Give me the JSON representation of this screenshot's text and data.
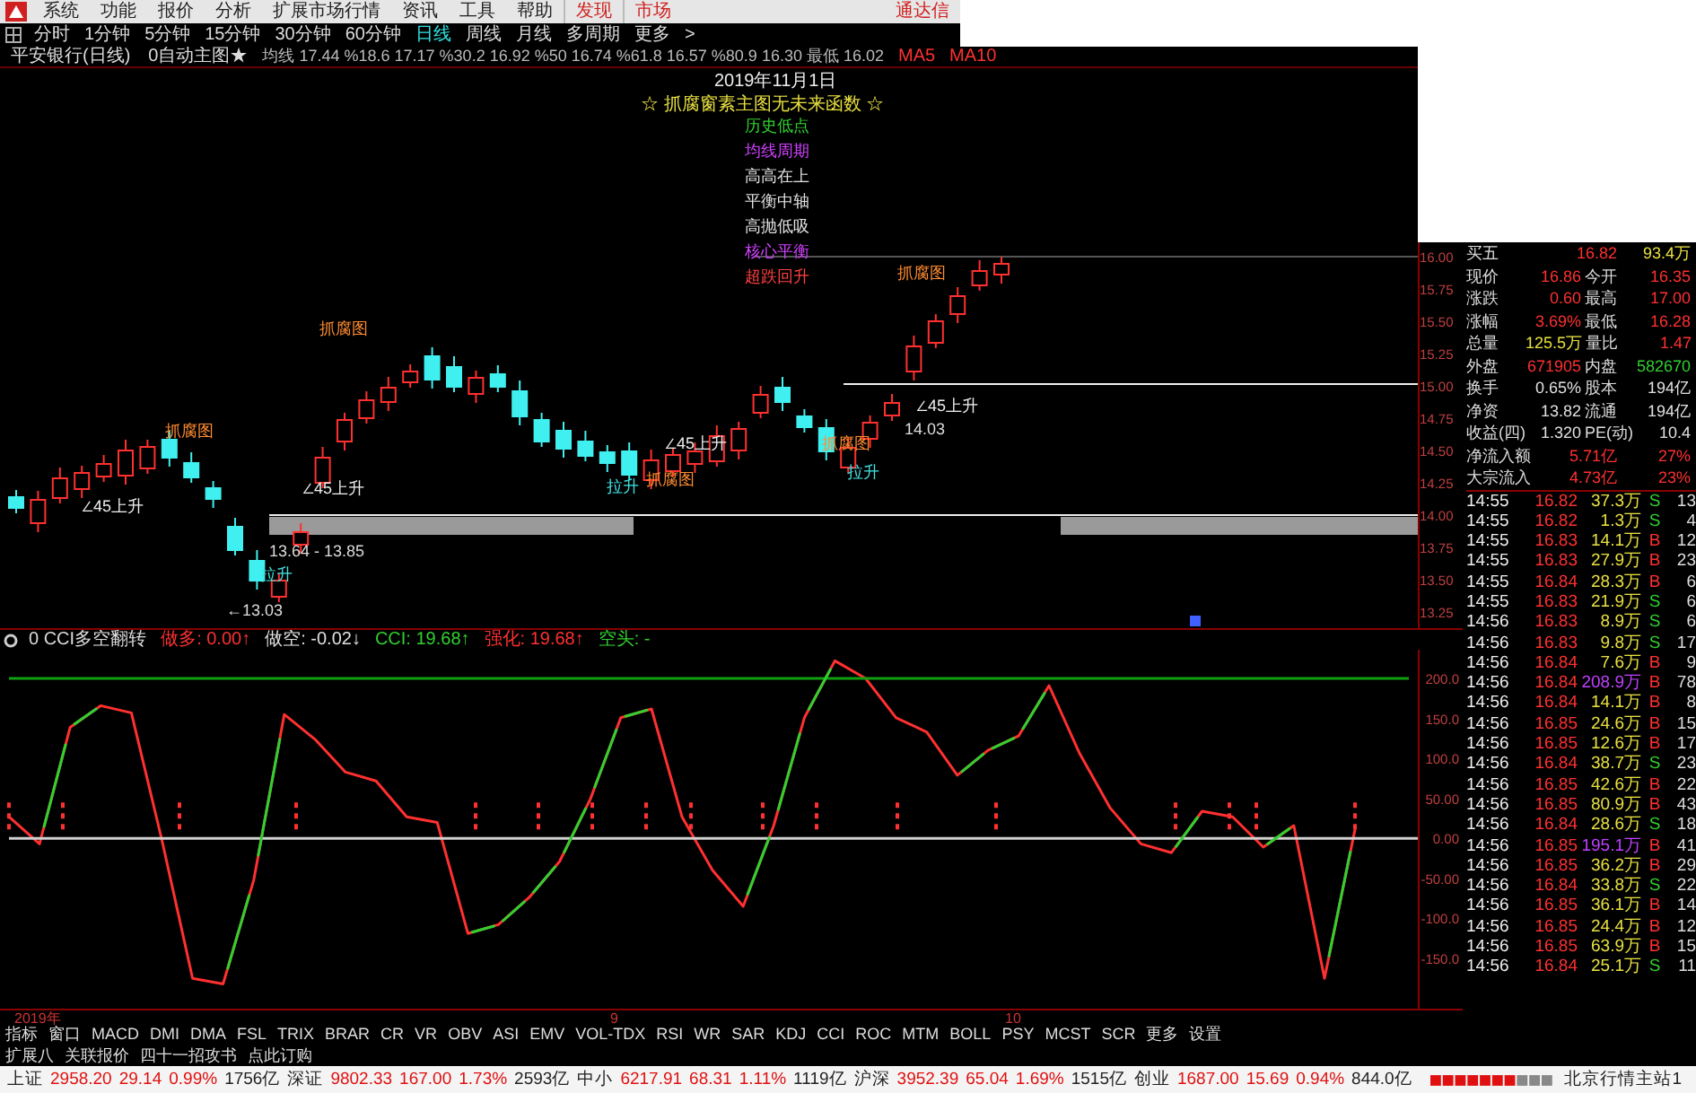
{
  "menu_bar": {
    "items": [
      {
        "label": "系统",
        "kind": "menu"
      },
      {
        "label": "功能",
        "kind": "menu"
      },
      {
        "label": "报价",
        "kind": "menu"
      },
      {
        "label": "分析",
        "kind": "menu"
      },
      {
        "label": "扩展市场行情",
        "kind": "menu"
      },
      {
        "label": "资讯",
        "kind": "menu"
      },
      {
        "label": "工具",
        "kind": "menu"
      },
      {
        "label": "帮助",
        "kind": "menu"
      },
      {
        "label": "发现",
        "kind": "feature"
      },
      {
        "label": "市场",
        "kind": "feature"
      }
    ],
    "brand": "通达信"
  },
  "period_bar": {
    "items": [
      {
        "label": "分时",
        "selected": false
      },
      {
        "label": "1分钟",
        "selected": false
      },
      {
        "label": "5分钟",
        "selected": false
      },
      {
        "label": "15分钟",
        "selected": false
      },
      {
        "label": "30分钟",
        "selected": false
      },
      {
        "label": "60分钟",
        "selected": false
      },
      {
        "label": "日线",
        "selected": true
      },
      {
        "label": "周线",
        "selected": false
      },
      {
        "label": "月线",
        "selected": false
      },
      {
        "label": "多周期",
        "selected": false
      },
      {
        "label": "更多",
        "selected": false
      }
    ],
    "arrow": ">"
  },
  "chart_header": {
    "title": "平安银行(日线)",
    "indicator": "0自动主图★",
    "values": "均线 17.44 %18.6 17.17 %30.2 16.92 %50 16.74 %61.8 16.57 %80.9 16.30 最低 16.02",
    "legend": [
      "MA5",
      "MA10"
    ]
  },
  "main_chart": {
    "date": "2019年11月1日",
    "caption": "☆ 抓腐窗素主图无未来函数 ☆",
    "levels": [
      {
        "label": "历史低点",
        "color": "#30d030"
      },
      {
        "label": "均线周期",
        "color": "#d040ff"
      },
      {
        "label": "高高在上",
        "color": "#e0e0e0"
      },
      {
        "label": "平衡中轴",
        "color": "#e0e0e0"
      },
      {
        "label": "高抛低吸",
        "color": "#e0e0e0"
      },
      {
        "label": "核心平衡",
        "color": "#d040ff"
      },
      {
        "label": "超跌回升",
        "color": "#ff4040"
      }
    ],
    "signals": [
      {
        "text": "抓腐图",
        "kind": "top"
      },
      {
        "text": "抓腐图",
        "kind": "top"
      },
      {
        "text": "抓腐图",
        "kind": "top"
      },
      {
        "text": "抓腐图",
        "kind": "top"
      },
      {
        "text": "抓腐图",
        "kind": "top"
      },
      {
        "text": "拉升",
        "kind": "rise"
      },
      {
        "text": "拉升",
        "kind": "rise"
      },
      {
        "text": "拉升",
        "kind": "rise"
      },
      {
        "text": "∠45上升",
        "kind": "trend"
      },
      {
        "text": "∠45上升",
        "kind": "trend"
      },
      {
        "text": "∠45上升",
        "kind": "trend"
      },
      {
        "text": "∠45上升",
        "kind": "trend"
      },
      {
        "text": "13.64 - 13.85",
        "kind": "note"
      },
      {
        "text": "←13.03",
        "kind": "note"
      },
      {
        "text": "14.03",
        "kind": "note"
      }
    ],
    "price_axis": [
      "16.00",
      "15.75",
      "15.50",
      "15.25",
      "15.00",
      "14.75",
      "14.50",
      "14.25",
      "14.00",
      "13.75",
      "13.50",
      "13.25"
    ]
  },
  "indicator_header": {
    "name": "0 CCI多空翻转",
    "items": [
      {
        "text": "做多: 0.00↑",
        "color": "#ff3030"
      },
      {
        "text": "做空: -0.02↓",
        "color": "#e0e0e0"
      },
      {
        "text": "CCI: 19.68↑",
        "color": "#30d030"
      },
      {
        "text": "强化: 19.68↑",
        "color": "#ff3030"
      },
      {
        "text": "空头: -",
        "color": "#30d030"
      }
    ]
  },
  "indicator_chart": {
    "chart_data": {
      "type": "line",
      "ylim": [
        -213,
        236
      ],
      "yticks": [
        {
          "value": 200,
          "label": "200.0"
        },
        {
          "value": 150,
          "label": "150.0"
        },
        {
          "value": 100,
          "label": "100.0"
        },
        {
          "value": 50,
          "label": "50.00"
        },
        {
          "value": 0,
          "label": "0.00"
        },
        {
          "value": -50,
          "label": "-50.00"
        },
        {
          "value": -100,
          "label": "-100.0"
        },
        {
          "value": -150,
          "label": "-150.0"
        }
      ],
      "categories": [
        null,
        null,
        null,
        null,
        null,
        null,
        null,
        null,
        null,
        null,
        null,
        null,
        null,
        null,
        null,
        null,
        null,
        null,
        null,
        null,
        null,
        null,
        null,
        null,
        null,
        null,
        null,
        null,
        null,
        null,
        null,
        null,
        null,
        null,
        null,
        null,
        null,
        null,
        null,
        null,
        null,
        null,
        null,
        null,
        null
      ],
      "series": [
        {
          "color": "#ff3030",
          "values": [
            27,
            -7,
            139,
            166,
            157,
            -2,
            -175,
            -182,
            -52,
            155,
            124,
            83,
            72,
            27,
            20,
            -119,
            -108,
            -74,
            -29,
            49,
            151,
            162,
            27,
            -40,
            -85,
            16,
            151,
            222,
            200,
            151,
            133,
            79,
            110,
            128,
            191,
            106,
            38,
            -7,
            -18,
            34,
            27,
            -11,
            16,
            -175,
            11
          ]
        }
      ]
    }
  },
  "date_axis": [
    "2019年",
    "9",
    "10"
  ],
  "indicator_tabs": [
    "指标",
    "窗口",
    "MACD",
    "DMI",
    "DMA",
    "FSL",
    "TRIX",
    "BRAR",
    "CR",
    "VR",
    "OBV",
    "ASI",
    "EMV",
    "VOL-TDX",
    "RSI",
    "WR",
    "SAR",
    "KDJ",
    "CCI",
    "ROC",
    "MTM",
    "BOLL",
    "PSY",
    "MCST",
    "SCR",
    "更多",
    "设置"
  ],
  "extra_links": [
    "扩展八",
    "关联报价",
    "四十一招攻书",
    "点此订购"
  ],
  "quote_panel": {
    "rows": [
      {
        "kind": "pair",
        "cells": [
          {
            "text": "买五"
          },
          {
            "text": "16.82",
            "color": "#ff3030"
          },
          {
            "text": "93.4万",
            "color": "#e8e040"
          }
        ]
      },
      {
        "kind": "quad",
        "cells": [
          {
            "text": "现价"
          },
          {
            "text": "16.86",
            "color": "#ff3030"
          },
          {
            "text": "今开"
          },
          {
            "text": "16.35",
            "color": "#ff3030"
          }
        ]
      },
      {
        "kind": "quad",
        "cells": [
          {
            "text": "涨跌"
          },
          {
            "text": "0.60",
            "color": "#ff3030"
          },
          {
            "text": "最高"
          },
          {
            "text": "17.00",
            "color": "#ff3030"
          }
        ]
      },
      {
        "kind": "quad",
        "cells": [
          {
            "text": "涨幅"
          },
          {
            "text": "3.69%",
            "color": "#ff3030"
          },
          {
            "text": "最低"
          },
          {
            "text": "16.28",
            "color": "#ff3030"
          }
        ]
      },
      {
        "kind": "quad",
        "cells": [
          {
            "text": "总量"
          },
          {
            "text": "125.5万",
            "color": "#e8e040"
          },
          {
            "text": "量比"
          },
          {
            "text": "1.47",
            "color": "#ff3030"
          }
        ]
      },
      {
        "kind": "quad",
        "cells": [
          {
            "text": "外盘"
          },
          {
            "text": "671905",
            "color": "#ff3030"
          },
          {
            "text": "内盘"
          },
          {
            "text": "582670",
            "color": "#30d030"
          }
        ]
      },
      {
        "kind": "quad",
        "cells": [
          {
            "text": "换手"
          },
          {
            "text": "0.65%",
            "color": "#e0e0e0"
          },
          {
            "text": "股本"
          },
          {
            "text": "194亿",
            "color": "#e0e0e0"
          }
        ]
      },
      {
        "kind": "quad",
        "cells": [
          {
            "text": "净资"
          },
          {
            "text": "13.82",
            "color": "#e0e0e0"
          },
          {
            "text": "流通"
          },
          {
            "text": "194亿",
            "color": "#e0e0e0"
          }
        ]
      },
      {
        "kind": "quad",
        "cells": [
          {
            "text": "收益(四)"
          },
          {
            "text": "1.320",
            "color": "#e0e0e0"
          },
          {
            "text": "PE(动)"
          },
          {
            "text": "10.4",
            "color": "#e0e0e0"
          }
        ]
      },
      {
        "kind": "pair",
        "cells": [
          {
            "text": "净流入额"
          },
          {
            "text": "5.71亿",
            "color": "#ff3030"
          },
          {
            "text": "27%",
            "color": "#ff3030"
          }
        ]
      },
      {
        "kind": "pair",
        "cells": [
          {
            "text": "大宗流入"
          },
          {
            "text": "4.73亿",
            "color": "#ff3030"
          },
          {
            "text": "23%",
            "color": "#ff3030"
          }
        ]
      }
    ],
    "ticks": [
      {
        "time": "14:55",
        "price": "16.82",
        "volume": "37.3万",
        "side": "S",
        "count": "13",
        "large": false
      },
      {
        "time": "14:55",
        "price": "16.82",
        "volume": "1.3万",
        "side": "S",
        "count": "4",
        "large": false
      },
      {
        "time": "14:55",
        "price": "16.83",
        "volume": "14.1万",
        "side": "B",
        "count": "12",
        "large": false
      },
      {
        "time": "14:55",
        "price": "16.83",
        "volume": "27.9万",
        "side": "B",
        "count": "23",
        "large": false
      },
      {
        "time": "14:55",
        "price": "16.84",
        "volume": "28.3万",
        "side": "B",
        "count": "6",
        "large": false
      },
      {
        "time": "14:55",
        "price": "16.83",
        "volume": "21.9万",
        "side": "S",
        "count": "6",
        "large": false
      },
      {
        "time": "14:56",
        "price": "16.83",
        "volume": "8.9万",
        "side": "S",
        "count": "6",
        "large": false
      },
      {
        "time": "14:56",
        "price": "16.83",
        "volume": "9.8万",
        "side": "S",
        "count": "17",
        "large": false
      },
      {
        "time": "14:56",
        "price": "16.84",
        "volume": "7.6万",
        "side": "B",
        "count": "9",
        "large": false
      },
      {
        "time": "14:56",
        "price": "16.84",
        "volume": "208.9万",
        "side": "B",
        "count": "78",
        "large": true
      },
      {
        "time": "14:56",
        "price": "16.84",
        "volume": "14.1万",
        "side": "B",
        "count": "8",
        "large": false
      },
      {
        "time": "14:56",
        "price": "16.85",
        "volume": "24.6万",
        "side": "B",
        "count": "15",
        "large": false
      },
      {
        "time": "14:56",
        "price": "16.85",
        "volume": "12.6万",
        "side": "B",
        "count": "17",
        "large": false
      },
      {
        "time": "14:56",
        "price": "16.84",
        "volume": "38.7万",
        "side": "S",
        "count": "23",
        "large": false
      },
      {
        "time": "14:56",
        "price": "16.85",
        "volume": "42.6万",
        "side": "B",
        "count": "22",
        "large": false
      },
      {
        "time": "14:56",
        "price": "16.85",
        "volume": "80.9万",
        "side": "B",
        "count": "43",
        "large": false
      },
      {
        "time": "14:56",
        "price": "16.84",
        "volume": "28.6万",
        "side": "S",
        "count": "18",
        "large": false
      },
      {
        "time": "14:56",
        "price": "16.85",
        "volume": "195.1万",
        "side": "B",
        "count": "41",
        "large": true
      },
      {
        "time": "14:56",
        "price": "16.85",
        "volume": "36.2万",
        "side": "B",
        "count": "29",
        "large": false
      },
      {
        "time": "14:56",
        "price": "16.84",
        "volume": "33.8万",
        "side": "S",
        "count": "22",
        "large": false
      },
      {
        "time": "14:56",
        "price": "16.85",
        "volume": "36.1万",
        "side": "B",
        "count": "14",
        "large": false
      },
      {
        "time": "14:56",
        "price": "16.85",
        "volume": "24.4万",
        "side": "B",
        "count": "12",
        "large": false
      },
      {
        "time": "14:56",
        "price": "16.85",
        "volume": "63.9万",
        "side": "B",
        "count": "15",
        "large": false
      },
      {
        "time": "14:56",
        "price": "16.84",
        "volume": "25.1万",
        "side": "S",
        "count": "11",
        "large": false
      }
    ]
  },
  "status_bar": {
    "indices": [
      {
        "name": "上证",
        "value": "2958.20",
        "change": "29.14",
        "pct": "0.99%",
        "amount": "1756亿"
      },
      {
        "name": "深证",
        "value": "9802.33",
        "change": "167.00",
        "pct": "1.73%",
        "amount": "2593亿"
      },
      {
        "name": "中小",
        "value": "6217.91",
        "change": "68.31",
        "pct": "1.11%",
        "amount": "1119亿"
      },
      {
        "name": "沪深",
        "value": "3952.39",
        "change": "65.04",
        "pct": "1.69%",
        "amount": "1515亿"
      },
      {
        "name": "创业",
        "value": "1687.00",
        "change": "15.69",
        "pct": "0.94%",
        "amount": "844.0亿"
      }
    ],
    "server": "北京行情主站1"
  }
}
